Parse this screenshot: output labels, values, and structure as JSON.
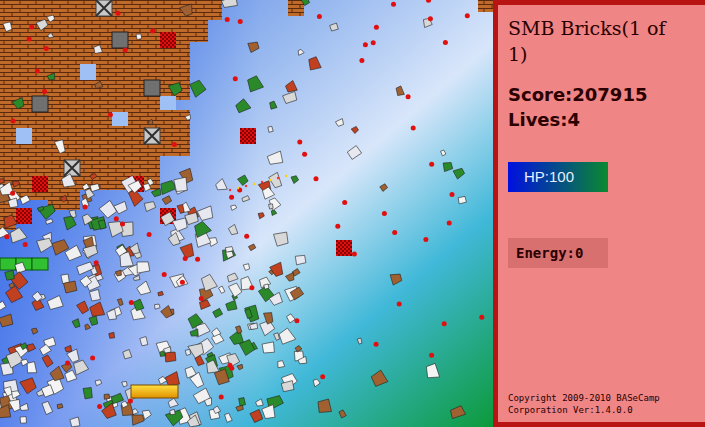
{
  "window": {
    "title": "SMB Bricks(1 of 1)"
  },
  "stats": {
    "score": "Score:207915",
    "lives": "Lives:4"
  },
  "hp": {
    "label": "HP:100",
    "level": 1
  },
  "energy": {
    "label": "Energy:0",
    "level": 0
  },
  "footer": {
    "copyright": "Copyright 2009-2010 BASeCamp Corporation Ver:1.4.0.0"
  }
}
